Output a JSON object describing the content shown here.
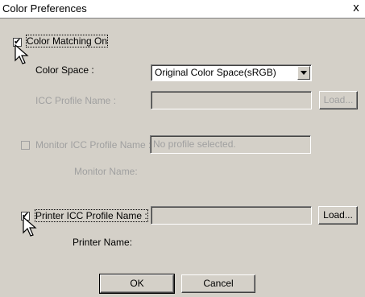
{
  "window": {
    "title": "Color Preferences",
    "close_label": "x"
  },
  "color_matching": {
    "label": "Color Matching On",
    "checked": true
  },
  "color_space": {
    "label": "Color Space :",
    "selected": "Original Color Space(sRGB)"
  },
  "icc_profile": {
    "label": "ICC Profile Name :",
    "value": "",
    "load_label": "Load..."
  },
  "monitor": {
    "checkbox_label": "Monitor ICC Profile Name :",
    "value": "No profile selected.",
    "name_label": "Monitor Name:",
    "checked": false
  },
  "printer": {
    "checkbox_label": "Printer ICC Profile Name :",
    "value": "",
    "load_label": "Load...",
    "name_label": "Printer Name:",
    "checked": true
  },
  "buttons": {
    "ok": "OK",
    "cancel": "Cancel"
  },
  "icons": {
    "cursor": "mouse-pointer-icon"
  }
}
